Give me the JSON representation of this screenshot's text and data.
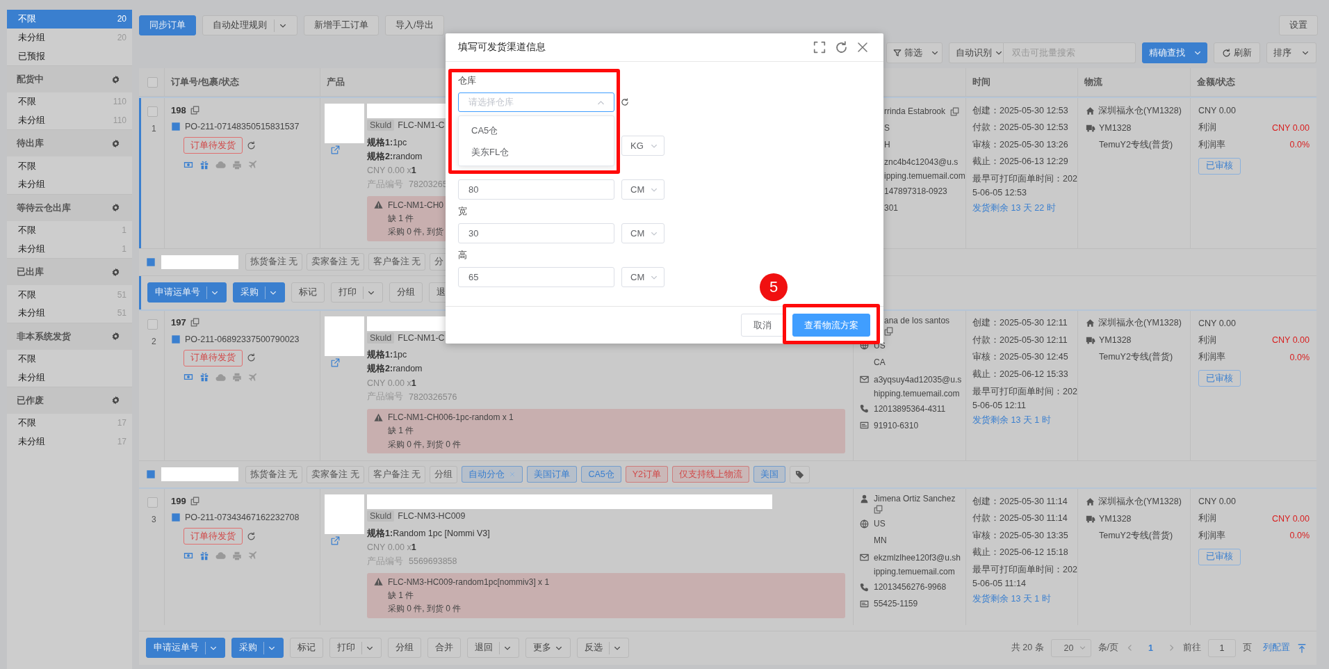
{
  "sidebar": {
    "groups": [
      {
        "items": [
          {
            "label": "不限",
            "count": "20",
            "selected": true
          },
          {
            "label": "未分组",
            "count": "20",
            "selected": false
          },
          {
            "label": "已预报",
            "selected": false
          }
        ]
      },
      {
        "title": "配货中",
        "items": [
          {
            "label": "不限",
            "count": "110",
            "selected": false
          },
          {
            "label": "未分组",
            "count": "110",
            "selected": false
          }
        ]
      },
      {
        "title": "待出库",
        "items": [
          {
            "label": "不限",
            "selected": false
          },
          {
            "label": "未分组",
            "selected": false
          }
        ]
      },
      {
        "title": "等待云仓出库",
        "items": [
          {
            "label": "不限",
            "count": "1",
            "selected": false
          },
          {
            "label": "未分组",
            "count": "1",
            "selected": false
          }
        ]
      },
      {
        "title": "已出库",
        "items": [
          {
            "label": "不限",
            "count": "51",
            "selected": false
          },
          {
            "label": "未分组",
            "count": "51",
            "selected": false
          }
        ]
      },
      {
        "title": "非本系统发货",
        "items": [
          {
            "label": "不限",
            "selected": false
          },
          {
            "label": "未分组",
            "selected": false
          }
        ]
      },
      {
        "title": "已作废",
        "items": [
          {
            "label": "不限",
            "count": "17",
            "selected": false
          },
          {
            "label": "未分组",
            "count": "17",
            "selected": false
          }
        ]
      }
    ]
  },
  "toolbar": {
    "buttons": [
      {
        "label": "同步订单",
        "kind": "primary"
      },
      {
        "label": "自动处理规则",
        "kind": "split"
      },
      {
        "label": "新增手工订单",
        "kind": "default"
      },
      {
        "label": "导入/导出",
        "kind": "default"
      }
    ],
    "settings": "设置"
  },
  "filter_bar": {
    "filter": "筛选",
    "search_mode": "自动识别",
    "search_placeholder": "双击可批量搜索",
    "search_button": "精确查找",
    "refresh": "刷新",
    "sort": "排序"
  },
  "table": {
    "all_checked": false,
    "columns": [
      "订单号/包裹/状态",
      "产品",
      "时间",
      "物流",
      "金额/状态"
    ],
    "orders": [
      {
        "active": true,
        "checked": false,
        "number": "198",
        "index": "1",
        "po": "PO-211-07148350515831537",
        "status": "订单待发货",
        "product": {
          "sku_tag": "Skuld",
          "sku": "FLC-NM1-C",
          "specs": [
            "**规格1:**1pc",
            "**规格2:**random"
          ],
          "price": "CNY 0.00 x ",
          "qty": "1",
          "code_label": "产品编号",
          "code": "78203265"
        },
        "alert": [
          "FLC-NM1-CH0",
          "缺 1 件",
          "采购 0 件, 到货"
        ],
        "customer": [
          {
            "kind": "name",
            "text": "rrinda Estabrook"
          },
          {
            "kind": "country",
            "text": "S"
          },
          {
            "kind": "state",
            "text": "H"
          },
          {
            "kind": "email",
            "lines": [
              "znc4b4c12043@u.s",
              "ipping.temuemail.com"
            ]
          },
          {
            "kind": "phone",
            "text": "147897318-0923"
          },
          {
            "kind": "zip",
            "text": "301"
          }
        ],
        "times": [
          "创建：2025-05-30 12:53",
          "付款：2025-05-30 12:53",
          "审核：2025-05-30 13:26",
          "截止：2025-06-13 12:29"
        ],
        "earliest": [
          "最早可打印面单时间：202",
          "5-06-05 12:53"
        ],
        "remaining": "发货剩余 13 天 22 时",
        "logistics": {
          "warehouse": "深圳福永仓(YM1328)",
          "carrier": "YM1328",
          "channel": "TemuY2专线(普货)"
        },
        "amount": {
          "total": "CNY 0.00",
          "profit_label": "利润",
          "profit": "CNY 0.00",
          "rate_label": "利润率",
          "rate": "0.0%",
          "status": "已审核"
        },
        "notes": [
          "拣货备注 无",
          "卖家备注 无",
          "客户备注 无",
          "分"
        ],
        "actions": [
          {
            "label": "申请运单号",
            "kind": "primary-split"
          },
          {
            "label": "采购",
            "kind": "primary-split"
          },
          {
            "label": "标记",
            "kind": "default"
          },
          {
            "label": "打印",
            "kind": "split"
          },
          {
            "label": "分组",
            "kind": "default"
          },
          {
            "label": "退",
            "kind": "default"
          }
        ]
      },
      {
        "active": false,
        "checked": false,
        "number": "197",
        "index": "2",
        "po": "PO-211-06892337500790023",
        "status": "订单待发货",
        "product": {
          "sku_tag": "Skuld",
          "sku": "FLC-NM1-C",
          "specs": [
            "**规格1:**1pc",
            "**规格2:**random"
          ],
          "price": "CNY 0.00 x ",
          "qty": "1",
          "code_label": "产品编号",
          "code": "7820326576"
        },
        "alert": [
          "FLC-NM1-CH006-1pc-random x 1",
          "缺 1 件",
          "采购 0 件, 到货 0 件"
        ],
        "customer": [
          {
            "kind": "name",
            "text": "ana de los santos"
          },
          {
            "kind": "country",
            "text": "US"
          },
          {
            "kind": "state",
            "text": "CA"
          },
          {
            "kind": "email",
            "lines": [
              "a3yqsuy4ad12035@u.s",
              "hipping.temuemail.com"
            ]
          },
          {
            "kind": "phone",
            "text": "12013895364-4311"
          },
          {
            "kind": "zip",
            "text": "91910-6310"
          }
        ],
        "times": [
          "创建：2025-05-30 12:11",
          "付款：2025-05-30 12:11",
          "审核：2025-05-30 12:45",
          "截止：2025-06-12 15:33"
        ],
        "earliest": [
          "最早可打印面单时间：202",
          "5-06-05 12:11"
        ],
        "remaining": "发货剩余 13 天 1 时",
        "logistics": {
          "warehouse": "深圳福永仓(YM1328)",
          "carrier": "YM1328",
          "channel": "TemuY2专线(普货)"
        },
        "amount": {
          "total": "CNY 0.00",
          "profit_label": "利润",
          "profit": "CNY 0.00",
          "rate_label": "利润率",
          "rate": "0.0%",
          "status": "已审核"
        },
        "notes": [
          "拣货备注 无",
          "卖家备注 无",
          "客户备注 无",
          "分组"
        ],
        "tags": [
          {
            "label": "自动分仓",
            "color": "#3a7fcf",
            "removable": true
          },
          {
            "label": "美国订单",
            "color": "#3a7fcf",
            "removable": false
          },
          {
            "label": "CA5仓",
            "color": "#3a7fcf",
            "removable": false
          },
          {
            "label": "Y2订单",
            "color": "#d04a4a",
            "removable": false
          },
          {
            "label": "仅支持线上物流",
            "color": "#d04a4a",
            "removable": false
          },
          {
            "label": "美国",
            "color": "#3a7fcf",
            "removable": false
          }
        ]
      },
      {
        "active": false,
        "checked": false,
        "number": "199",
        "index": "3",
        "po": "PO-211-07343467162232708",
        "status": "订单待发货",
        "product": {
          "sku_tag": "Skuld",
          "sku": "FLC-NM3-HC009",
          "specs": [
            "**规格1:**Random 1pc [Nommi V3]"
          ],
          "price": "CNY 0.00 x ",
          "qty": "1",
          "code_label": "产品编号",
          "code": "5569693858"
        },
        "alert": [
          "FLC-NM3-HC009-random1pc[nommiv3] x 1",
          "缺 1 件",
          "采购 0 件, 到货 0 件"
        ],
        "customer": [
          {
            "kind": "name",
            "text": "Jimena Ortiz Sanchez"
          },
          {
            "kind": "country",
            "text": "US"
          },
          {
            "kind": "state",
            "text": "MN"
          },
          {
            "kind": "email",
            "lines": [
              "ekzmlzlhee120f3@u.sh",
              "ipping.temuemail.com"
            ]
          },
          {
            "kind": "phone",
            "text": "12013456276-9968"
          },
          {
            "kind": "zip",
            "text": "55425-1159"
          }
        ],
        "times": [
          "创建：2025-05-30 11:14",
          "付款：2025-05-30 11:14",
          "审核：2025-05-30 13:35",
          "截止：2025-06-12 15:18"
        ],
        "earliest": [
          "最早可打印面单时间：202",
          "5-06-05 11:14"
        ],
        "remaining": "发货剩余 13 天 1 时",
        "logistics": {
          "warehouse": "深圳福永仓(YM1328)",
          "carrier": "YM1328",
          "channel": "TemuY2专线(普货)"
        },
        "amount": {
          "total": "CNY 0.00",
          "profit_label": "利润",
          "profit": "CNY 0.00",
          "rate_label": "利润率",
          "rate": "0.0%",
          "status": "已审核"
        }
      }
    ]
  },
  "bottom_bar": {
    "buttons": [
      {
        "label": "申请运单号",
        "kind": "primary-split"
      },
      {
        "label": "采购",
        "kind": "primary-split"
      },
      {
        "label": "标记",
        "kind": "default"
      },
      {
        "label": "打印",
        "kind": "split"
      },
      {
        "label": "分组",
        "kind": "default"
      },
      {
        "label": "合并",
        "kind": "default"
      },
      {
        "label": "退回",
        "kind": "split"
      },
      {
        "label": "更多",
        "kind": "menu"
      },
      {
        "label": "反选",
        "kind": "split"
      }
    ],
    "pagination": {
      "total": "共 20 条",
      "page_size": "20",
      "per_page": "条/页",
      "pages": [
        {
          "label": "1",
          "selected": true
        }
      ],
      "goto": "前往",
      "goto_value": "1",
      "page_unit": "页",
      "column_config": "列配置"
    }
  },
  "dialog": {
    "title": "填写可发货渠道信息",
    "fields": [
      {
        "kind": "select",
        "label": "仓库",
        "placeholder": "请选择仓库",
        "expanded": true,
        "options": [
          "CA5仓",
          "美东FL仓"
        ]
      },
      {
        "kind": "measure",
        "unit": "KG"
      },
      {
        "kind": "measure",
        "value": "80",
        "unit": "CM"
      },
      {
        "kind": "measure",
        "label": "宽",
        "value": "30",
        "unit": "CM"
      },
      {
        "kind": "measure",
        "label": "高",
        "value": "65",
        "unit": "CM"
      }
    ],
    "buttons": [
      {
        "label": "取消",
        "kind": "default"
      },
      {
        "label": "查看物流方案",
        "kind": "primary"
      }
    ]
  },
  "annotation": {
    "step": "5"
  }
}
